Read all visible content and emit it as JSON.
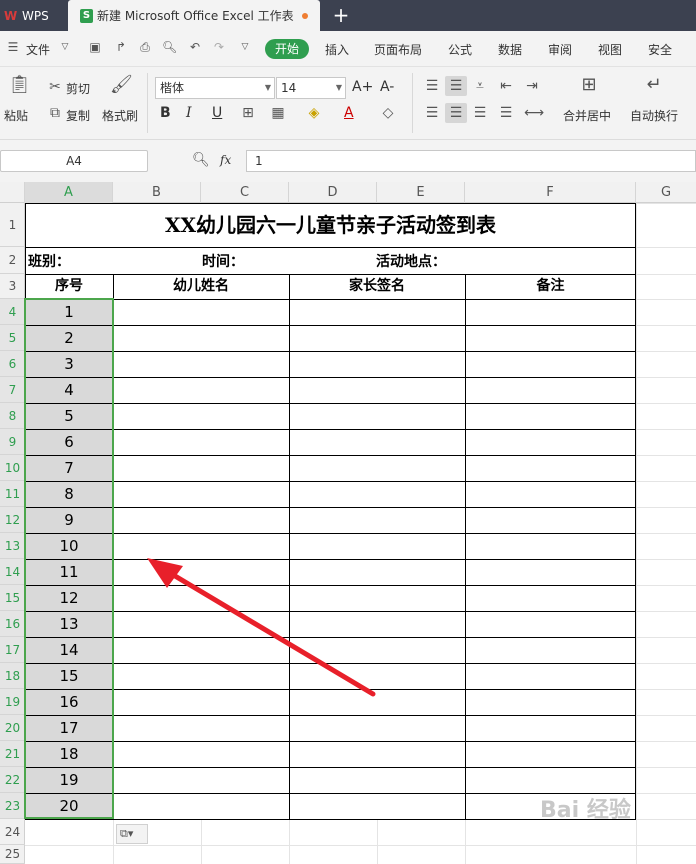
{
  "titlebar": {
    "app_name": "WPS",
    "doc_tab": "新建 Microsoft Office Excel 工作表",
    "new_tab": "+"
  },
  "menubar": {
    "file": "文件",
    "items": [
      "开始",
      "插入",
      "页面布局",
      "公式",
      "数据",
      "审阅",
      "视图",
      "安全"
    ]
  },
  "ribbon": {
    "paste": "粘贴",
    "cut": "剪切",
    "copy": "复制",
    "format_painter": "格式刷",
    "font_name": "楷体",
    "font_size": "14",
    "bold": "B",
    "italic": "I",
    "underline": "U",
    "font_color": "A",
    "grow_font": "A+",
    "shrink_font": "A-",
    "merge_center": "合并居中",
    "wrap_text": "自动换行"
  },
  "formula_bar": {
    "name_box": "A4",
    "fx": "fx",
    "formula": "1"
  },
  "grid": {
    "columns": [
      "A",
      "B",
      "C",
      "D",
      "E",
      "F",
      "G"
    ],
    "rows": [
      "1",
      "2",
      "3",
      "4",
      "5",
      "6",
      "7",
      "8",
      "9",
      "10",
      "11",
      "12",
      "13",
      "14",
      "15",
      "16",
      "17",
      "18",
      "19",
      "20",
      "21",
      "22",
      "23",
      "24",
      "25"
    ]
  },
  "sheet": {
    "title": "XX幼儿园六一儿童节亲子活动签到表",
    "class_label": "班别：",
    "time_label": "时间：",
    "location_label": "活动地点：",
    "headers": [
      "序号",
      "幼儿姓名",
      "家长签名",
      "备注"
    ],
    "serials": [
      "1",
      "2",
      "3",
      "4",
      "5",
      "6",
      "7",
      "8",
      "9",
      "10",
      "11",
      "12",
      "13",
      "14",
      "15",
      "16",
      "17",
      "18",
      "19",
      "20"
    ]
  },
  "watermark": "Bai 经验",
  "colors": {
    "accent": "#2f9e4f",
    "selection": "#4ca64c",
    "arrow": "#e8202a"
  }
}
